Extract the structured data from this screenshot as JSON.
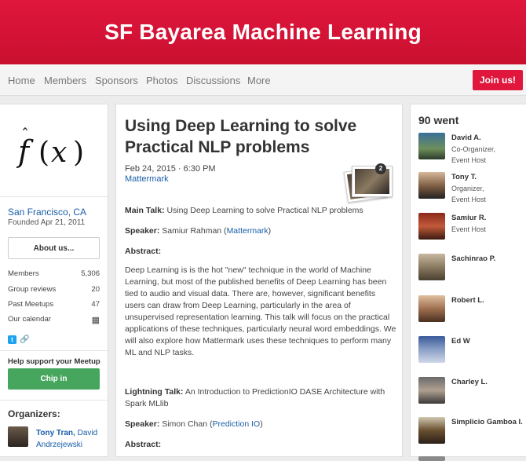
{
  "header": {
    "group_name": "SF Bayarea Machine Learning"
  },
  "nav": {
    "items": [
      "Home",
      "Members",
      "Sponsors",
      "Photos",
      "Discussions",
      "More"
    ],
    "join_label": "Join us!"
  },
  "sidebar": {
    "location": "San Francisco, CA",
    "founded": "Founded Apr 21, 2011",
    "about_label": "About us...",
    "stats": [
      {
        "label": "Members",
        "value": "5,306"
      },
      {
        "label": "Group reviews",
        "value": "20"
      },
      {
        "label": "Past Meetups",
        "value": "47"
      },
      {
        "label": "Our calendar",
        "value": ""
      }
    ],
    "support_label": "Help support your Meetup",
    "chip_label": "Chip in",
    "organizers_title": "Organizers:",
    "organizer_primary": "Tony Tran,",
    "organizer_rest": "David Andrzejewski"
  },
  "event": {
    "title": "Using Deep Learning to solve Practical NLP problems",
    "date": "Feb 24, 2015 · 6:30 PM",
    "venue": "Mattermark",
    "photo_count": "2",
    "main_talk_label": "Main Talk:",
    "main_talk_text": "Using Deep Learning to solve Practical NLP problems",
    "speaker_label": "Speaker:",
    "speaker_name": "Samiur Rahman (",
    "speaker_org": "Mattermark",
    "speaker_close": ")",
    "abstract_label": "Abstract:",
    "abstract_text": "Deep Learning is is the hot \"new\" technique in the world of Machine Learning, but most of the published benefits of Deep Learning has been tied to audio and visual data. There are, however, significant benefits users can draw from Deep Learning, particularly in the area of unsupervised representation learning. This talk will focus on the practical applications of these techniques, particularly neural word embeddings. We will also explore how Mattermark uses these techniques to perform many ML and NLP tasks.",
    "lightning_label": "Lightning Talk:",
    "lightning_text": "An Introduction to PredictionIO DASE Architecture with Spark MLlib",
    "speaker2_label": "Speaker:",
    "speaker2_name": "Simon Chan (",
    "speaker2_org": "Prediction IO",
    "speaker2_close": ")",
    "abstract2_label": "Abstract:"
  },
  "attendees": {
    "title": "90 went",
    "people": [
      {
        "name": "David A.",
        "role1": "Co-Organizer,",
        "role2": "Event Host"
      },
      {
        "name": "Tony T.",
        "role1": "Organizer,",
        "role2": "Event Host"
      },
      {
        "name": "Samiur R.",
        "role1": "Event Host",
        "role2": ""
      },
      {
        "name": "Sachinrao P.",
        "role1": "",
        "role2": ""
      },
      {
        "name": "Robert L.",
        "role1": "",
        "role2": ""
      },
      {
        "name": "Ed W",
        "role1": "",
        "role2": ""
      },
      {
        "name": "Charley L.",
        "role1": "",
        "role2": ""
      },
      {
        "name": "Simplicio Gamboa I.",
        "role1": "",
        "role2": ""
      }
    ]
  },
  "colors": {
    "brand": "#e0163d",
    "link": "#1a5ea8",
    "chip": "#47a65d"
  }
}
